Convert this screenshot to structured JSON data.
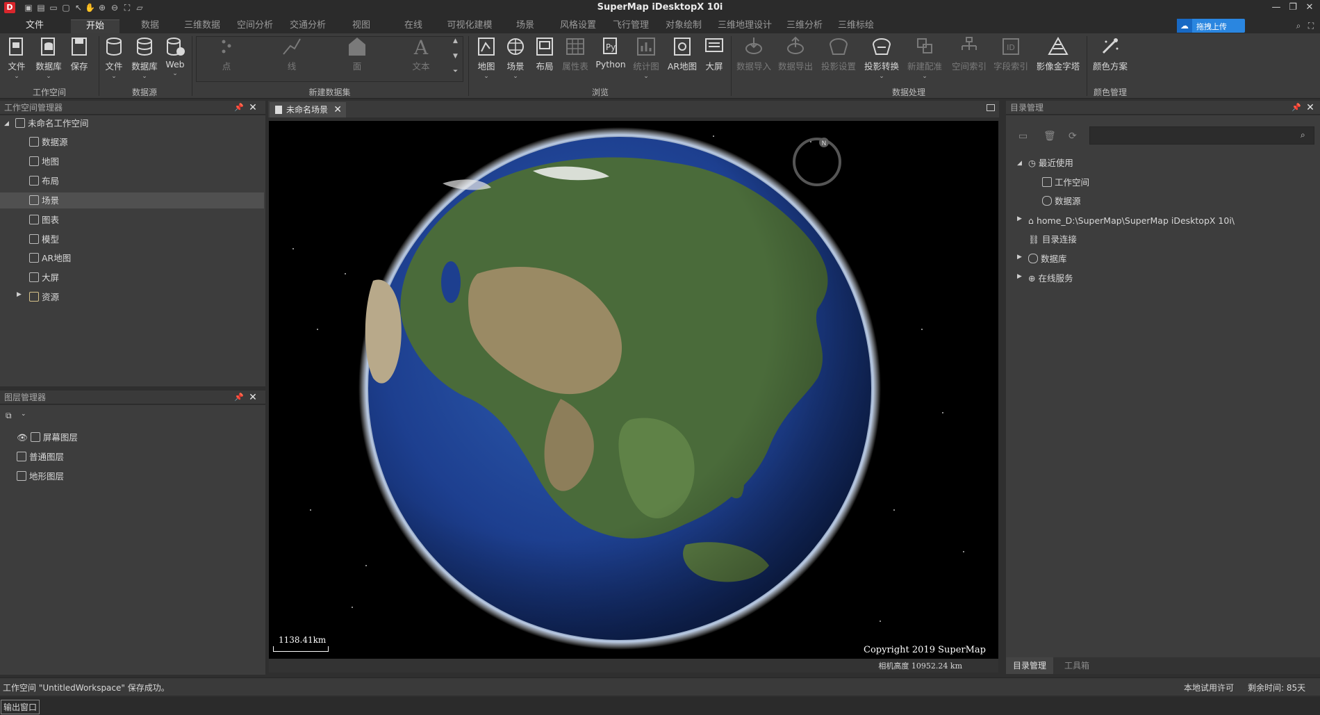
{
  "window": {
    "title": "SuperMap iDesktopX 10i",
    "controls": [
      "minimize-icon",
      "restore-icon",
      "close-icon"
    ]
  },
  "quick_access_icons": [
    "save-icon",
    "save-all-icon",
    "new-icon",
    "open-icon",
    "select-icon",
    "pan-icon",
    "zoom-in-icon",
    "zoom-out-icon",
    "full-extent-icon",
    "folder-icon"
  ],
  "menu": {
    "tabs": [
      {
        "label": "文件",
        "active": false
      },
      {
        "label": "开始",
        "active": true
      },
      {
        "label": "数据",
        "active": false
      },
      {
        "label": "三维数据",
        "active": false
      },
      {
        "label": "空间分析",
        "active": false
      },
      {
        "label": "交通分析",
        "active": false
      },
      {
        "label": "视图",
        "active": false
      },
      {
        "label": "在线",
        "active": false
      },
      {
        "label": "可视化建模",
        "active": false
      },
      {
        "label": "场景",
        "active": false
      },
      {
        "label": "风格设置",
        "active": false
      },
      {
        "label": "飞行管理",
        "active": false
      },
      {
        "label": "对象绘制",
        "active": false
      },
      {
        "label": "三维地理设计",
        "active": false
      },
      {
        "label": "三维分析",
        "active": false
      },
      {
        "label": "三维标绘",
        "active": false
      }
    ],
    "upload_label": "拖拽上传"
  },
  "ribbon": {
    "workspace": {
      "label": "工作空间",
      "buttons": [
        "文件",
        "数据库",
        "保存"
      ]
    },
    "datasource": {
      "label": "数据源",
      "buttons": [
        "文件",
        "数据库",
        "Web"
      ]
    },
    "new_dataset": {
      "label": "新建数据集",
      "buttons": [
        "点",
        "线",
        "面",
        "文本"
      ]
    },
    "browse": {
      "label": "浏览",
      "buttons": [
        "地图",
        "场景",
        "布局",
        "属性表",
        "Python",
        "统计图",
        "AR地图",
        "大屏"
      ]
    },
    "data_processing": {
      "label": "数据处理",
      "buttons": [
        "数据导入",
        "数据导出",
        "投影设置",
        "投影转换",
        "新建配准",
        "空间索引",
        "字段索引",
        "影像金字塔"
      ]
    },
    "color": {
      "label": "颜色管理",
      "buttons": [
        "颜色方案"
      ]
    }
  },
  "workspace_manager": {
    "title": "工作空间管理器",
    "root": "未命名工作空间",
    "items": [
      "数据源",
      "地图",
      "布局",
      "场景",
      "图表",
      "模型",
      "AR地图",
      "大屏",
      "资源"
    ],
    "selected": "场景"
  },
  "layer_manager": {
    "title": "图层管理器",
    "items": [
      "屏幕图层",
      "普通图层",
      "地形图层"
    ]
  },
  "document": {
    "tab_label": "未命名场景",
    "scale_text": "1138.41km",
    "copyright": "Copyright 2019 SuperMap",
    "camera_height": "相机高度 10952.24 km",
    "compass_label": "N"
  },
  "catalog": {
    "title": "目录管理",
    "search_placeholder": "",
    "items": [
      {
        "label": "最近使用",
        "level": 0,
        "expanded": true
      },
      {
        "label": "工作空间",
        "level": 1
      },
      {
        "label": "数据源",
        "level": 1
      },
      {
        "label": "home_D:\\SuperMap\\SuperMap iDesktopX 10i\\",
        "level": 0,
        "expanded": false
      },
      {
        "label": "目录连接",
        "level": 0
      },
      {
        "label": "数据库",
        "level": 0,
        "expanded": false
      },
      {
        "label": "在线服务",
        "level": 0,
        "expanded": false
      }
    ],
    "bottom_tabs": [
      "目录管理",
      "工具箱"
    ]
  },
  "status": {
    "message": "工作空间 \"UntitledWorkspace\" 保存成功。",
    "license": "本地试用许可",
    "remaining": "剩余时间: 85天",
    "output_window": "输出窗口"
  },
  "colors": {
    "background": "#2f2f2f",
    "panel": "#3d3d3d",
    "accent": "#2a86e0",
    "brand_red": "#d9262c"
  }
}
